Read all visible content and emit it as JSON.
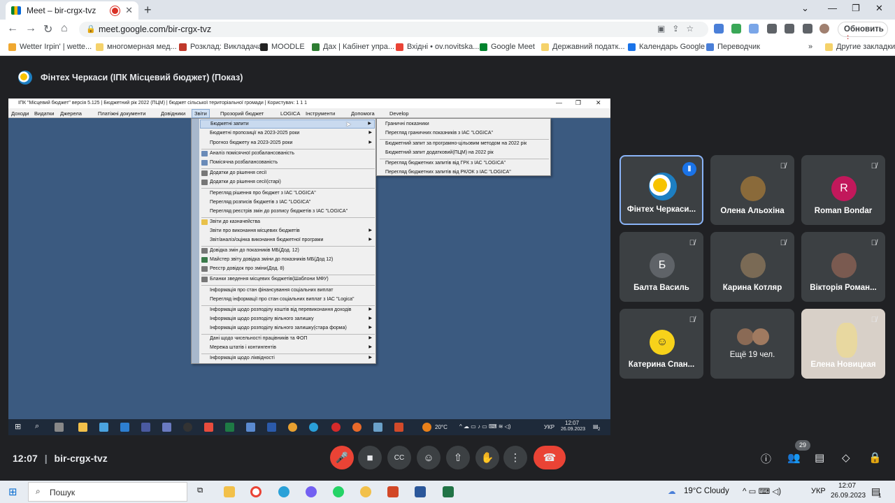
{
  "browser": {
    "tab_title": "Meet – bir-crgx-tvz",
    "url": "meet.google.com/bir-crgx-tvz",
    "update_button": "Обновить",
    "bookmarks": [
      "Wetter Irpin' | wette...",
      "многомерная мед...",
      "Розклад: Викладача",
      "MOODLE",
      "Дах | Кабінет упра...",
      "Вхідні • ov.novitska...",
      "Google Meet",
      "Державний податк...",
      "Календарь Google",
      "Переводчик"
    ],
    "other_bookmarks": "Другие закладки"
  },
  "meet": {
    "presenter_title": "Фінтех Черкаси (ІПК Місцевий бюджет) (Показ)",
    "meeting_code": "bir-crgx-tvz",
    "time": "12:07",
    "people_count": "29"
  },
  "app": {
    "title": "ІПК \"Місцевий бюджет\"  версія 5.125  | Бюджетний рік 2022 (ПЦМ) | бюджет сільської територіальної громади | Користувач: 1 1 1",
    "menu": [
      "Доходи",
      "Видатки",
      "Джерела",
      "Платіжні документи",
      "Довідники",
      "Звіти",
      "Прозорий бюджет",
      "LOGICA",
      "Інструменти",
      "Допомога",
      "Develop"
    ],
    "reports_menu": [
      "Бюджетні запити",
      "Бюджетні пропозиції на 2023-2025 роки",
      "Прогноз бюджету на 2023-2025 роки",
      "Аналіз помісячної розбалансованість",
      "Помісячна розбалансованість",
      "Додатки до рішення сесії",
      "Додатки до рішення сесії(старі)",
      "Перегляд рішення про бюджет  з ІАС \"LOGICA\"",
      "Перегляд розписів бюджетів  з ІАС \"LOGICA\"",
      "Перегляд реєстрів змін до розпису бюджетів  з ІАС \"LOGICA\"",
      "Звіти до казначейства",
      "Звіти про виконання місцевих бюджетів",
      "Звіт/аналіз/оцінка виконання бюджетної програми",
      "Довідка змін до показників МБ(Дод. 12)",
      "Майстер звіту довідка зміни до показників МБ(Дод 12)",
      "Реєстр довідок про зміни(Дод. 8)",
      "Бланки зведення місцевих бюджетів(Шаблони МФУ)",
      "Інформація про стан фінансування соціальних виплат",
      "Перегляд інформації про стан соціальних виплат з ІАС \"Logica\"",
      "Інформація щодо розподілу коштів від перевиконання доходів",
      "Інформація щодо розподілу вільного залишку",
      "Інформація щодо розподілу вільного залишку(стара форма)",
      "Дані щодо чисельності працівників та ФОП",
      "Мережа штатів і контингентів",
      "Інформація щодо ліквідності"
    ],
    "submenu": [
      "Граничні показники",
      "Перегляд граничних показників  з ІАС \"LOGICA\"",
      "Бюджетний запит за програмно-цільовим методом на 2022 рік",
      "Бюджетний запит додатковий(ПЦМ) на 2022 рік",
      "Перегляд бюджетних запитів від ГРК з ІАС \"LOGICA\"",
      "Перегляд бюджетних запитів від РК/ОК з ІАС \"LOGICA\""
    ],
    "inner_taskbar": {
      "temp": "20°C",
      "lang": "УКР",
      "time": "12:07",
      "date": "26.09.2023",
      "notif": "2"
    }
  },
  "participants": [
    {
      "name": "Фінтех Черкаси...",
      "initial": "",
      "color": "#ffffff"
    },
    {
      "name": "Олена Альохіна",
      "initial": "",
      "color": "#8a6a3a"
    },
    {
      "name": "Roman Bondar",
      "initial": "R",
      "color": "#c2185b"
    },
    {
      "name": "Балта Василь",
      "initial": "Б",
      "color": "#5f6368"
    },
    {
      "name": "Карина Котляр",
      "initial": "",
      "color": "#7a6a55"
    },
    {
      "name": "Вікторія Роман...",
      "initial": "",
      "color": "#7a5a50"
    },
    {
      "name": "Катерина Спан...",
      "initial": "",
      "color": "#f7d21a"
    },
    {
      "name": "Ещё 19 чел.",
      "initial": "",
      "color": "#8a6a55"
    },
    {
      "name": "Елена Новицкая",
      "initial": "",
      "color": "#d8d0c8"
    }
  ],
  "os_taskbar": {
    "search": "Пошук",
    "weather": "19°C  Cloudy",
    "lang": "УКР",
    "time": "12:07",
    "date": "26.09.2023",
    "notif": "1"
  }
}
